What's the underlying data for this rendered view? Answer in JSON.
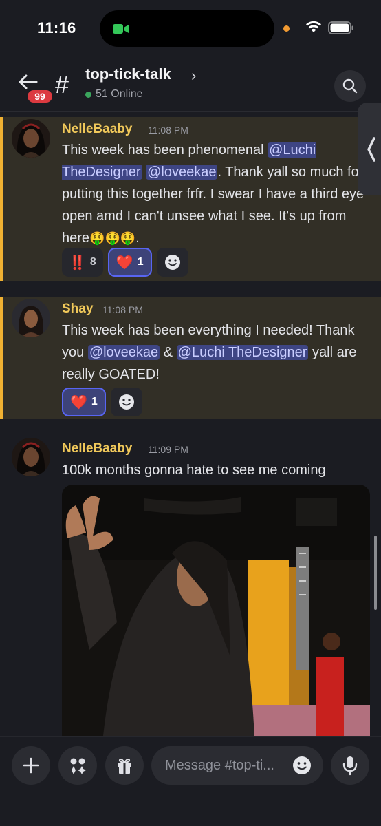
{
  "status_bar": {
    "time": "11:16"
  },
  "header": {
    "badge_count": "99",
    "hash": "#",
    "channel_name": "top-tick-talk",
    "chevron": "›",
    "online_text": "51 Online"
  },
  "messages": [
    {
      "author": "NelleBaaby",
      "time": "11:08 PM",
      "text_parts": [
        "This week has been phenomenal ",
        "@Luchi TheDesigner",
        " ",
        "@loveekae",
        ". Thank yall so much for putting this together frfr. I swear I have a third eye open amd I can't unsee what I see. It's up from here",
        "🤑🤑🤑",
        "."
      ],
      "reactions": [
        {
          "emoji": "‼️",
          "count": "8",
          "active": false
        },
        {
          "emoji": "❤️",
          "count": "1",
          "active": true
        }
      ]
    },
    {
      "author": "Shay",
      "time": "11:08 PM",
      "text_parts": [
        "This week has been everything I needed! Thank you ",
        "@loveekae",
        " & ",
        "@Luchi TheDesigner",
        " yall are really GOATED!"
      ],
      "reactions": [
        {
          "emoji": "❤️",
          "count": "1",
          "active": true
        }
      ]
    },
    {
      "author": "NelleBaaby",
      "time": "11:09 PM",
      "text": "100k months gonna hate to see me coming"
    }
  ],
  "composer": {
    "placeholder": "Message #top-ti..."
  },
  "colors": {
    "background": "#1b1c22",
    "highlight_bg": "#322f26",
    "highlight_bar": "#f0b132",
    "author_color": "#f0c85a",
    "mention_bg": "#3e4584",
    "badge": "#dc3a40",
    "online_dot": "#3ba55d"
  },
  "icons": [
    "video-camera-icon",
    "wifi-icon",
    "battery-icon",
    "back-arrow-icon",
    "search-icon",
    "chevron-left-icon",
    "add-reaction-icon",
    "plus-icon",
    "apps-icon",
    "gift-icon",
    "emoji-icon",
    "microphone-icon"
  ]
}
